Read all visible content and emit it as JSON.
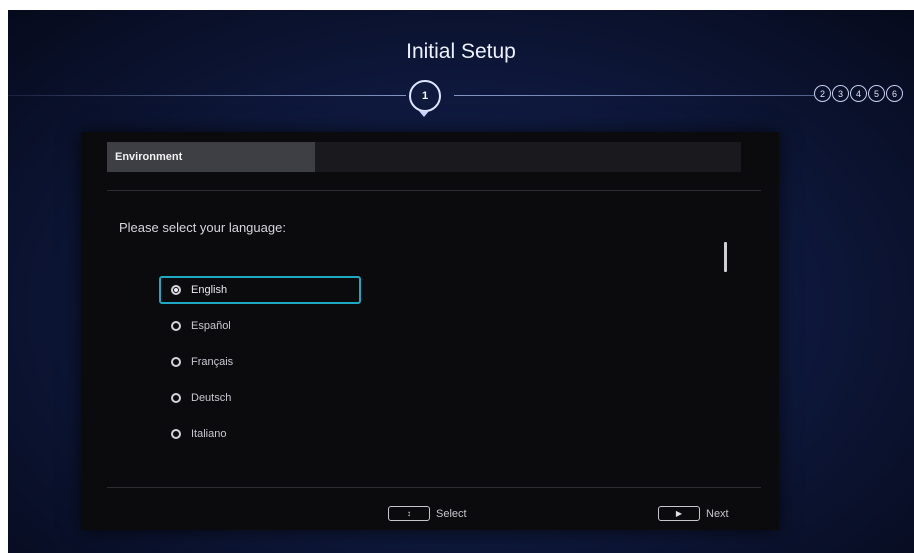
{
  "header": {
    "title": "Initial Setup",
    "current_step": "1",
    "future_steps": [
      "2",
      "3",
      "4",
      "5",
      "6"
    ]
  },
  "panel": {
    "tab_label": "Environment",
    "prompt": "Please select your language:",
    "options": [
      {
        "label": "English",
        "selected": true
      },
      {
        "label": "Español",
        "selected": false
      },
      {
        "label": "Français",
        "selected": false
      },
      {
        "label": "Deutsch",
        "selected": false
      },
      {
        "label": "Italiano",
        "selected": false
      }
    ]
  },
  "footer": {
    "select_label": "Select",
    "next_label": "Next",
    "select_key_icon": "dpad-updown-icon",
    "next_key_icon": "play-right-icon"
  },
  "colors": {
    "accent": "#1fa8c4",
    "background": "#0f1a40",
    "panel": "#0b0b0e"
  }
}
